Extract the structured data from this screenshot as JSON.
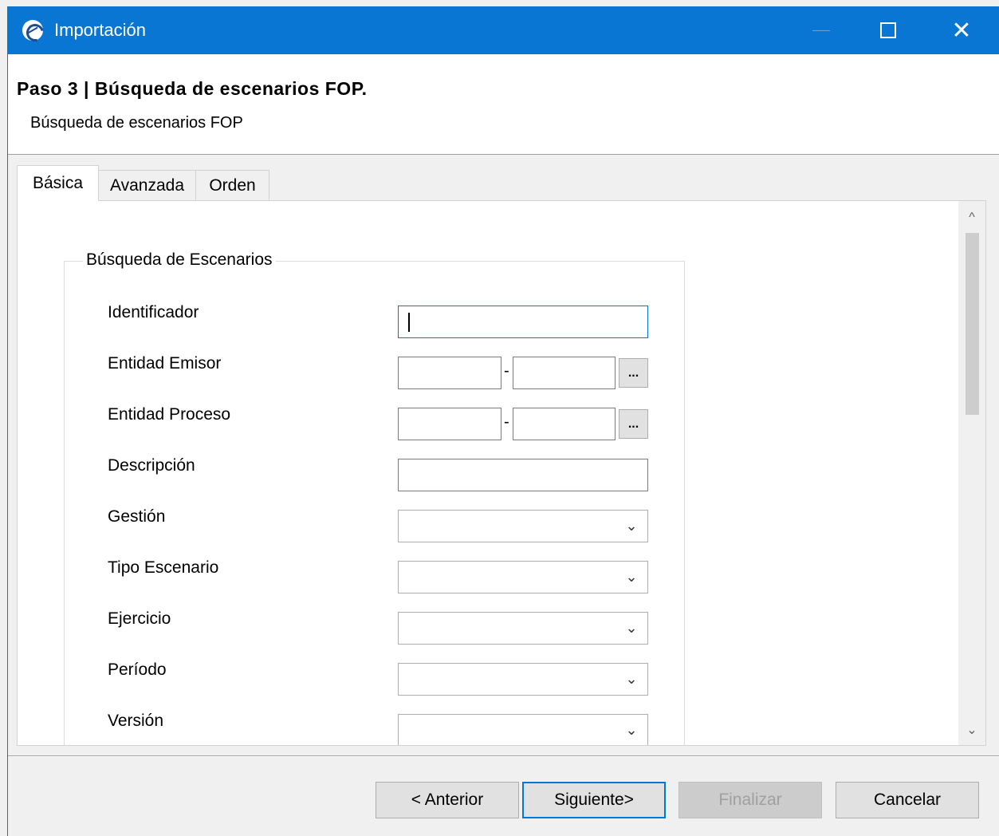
{
  "window": {
    "title": "Importación",
    "close_glyph": "✕"
  },
  "header": {
    "step_title": "Paso 3 | Búsqueda de escenarios FOP.",
    "step_subtitle": "Búsqueda de escenarios FOP"
  },
  "tabs": [
    {
      "label": "Básica",
      "active": true
    },
    {
      "label": "Avanzada",
      "active": false
    },
    {
      "label": "Orden",
      "active": false
    }
  ],
  "form": {
    "group_title": "Búsqueda de Escenarios",
    "fields": {
      "identificador": {
        "label": "Identificador",
        "value": ""
      },
      "entidad_emisor": {
        "label": "Entidad Emisor",
        "value_from": "",
        "value_to": "",
        "separator": "-",
        "browse_label": "..."
      },
      "entidad_proceso": {
        "label": "Entidad Proceso",
        "value_from": "",
        "value_to": "",
        "separator": "-",
        "browse_label": "..."
      },
      "descripcion": {
        "label": "Descripción",
        "value": ""
      },
      "gestion": {
        "label": "Gestión",
        "selected": ""
      },
      "tipo_escenario": {
        "label": "Tipo Escenario",
        "selected": ""
      },
      "ejercicio": {
        "label": "Ejercicio",
        "selected": ""
      },
      "periodo": {
        "label": "Período",
        "selected": ""
      },
      "version": {
        "label": "Versión",
        "selected": ""
      }
    },
    "combo_arrow": "⌄"
  },
  "scrollbar": {
    "up": "^",
    "down": "⌄"
  },
  "buttons": {
    "anterior": "< Anterior",
    "siguiente": "Siguiente>",
    "finalizar": "Finalizar",
    "cancelar": "Cancelar"
  },
  "colors": {
    "titlebar": "#0a76d4",
    "focus": "#0078d7",
    "close_mark": "#e81123"
  }
}
